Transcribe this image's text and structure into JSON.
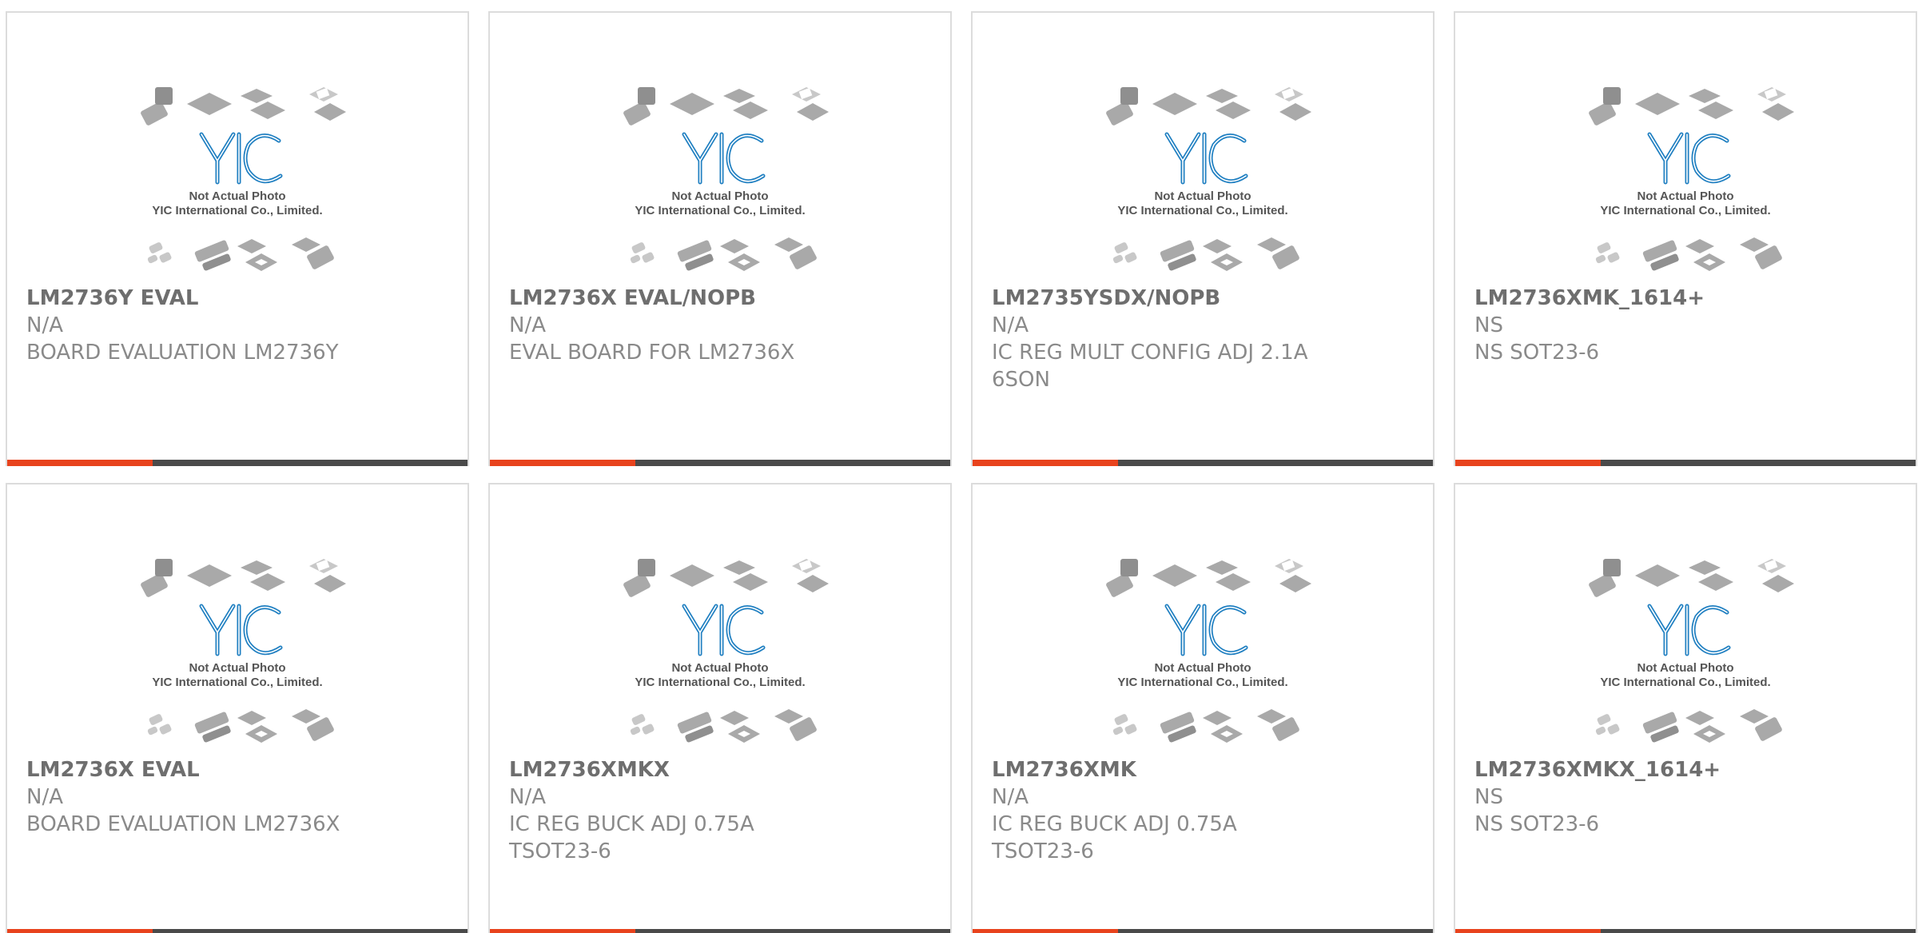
{
  "colors": {
    "accent_orange": "#e8431d",
    "accent_dark": "#4a4a4a",
    "card_border": "#dcdcdc",
    "part_number_text": "#6e6e6e",
    "meta_text": "#8a8a8a",
    "logo_blue": "#1f7fc1"
  },
  "placeholder_image": {
    "logo_text": "YIC",
    "caption_line1": "Not Actual Photo",
    "caption_line2": "YIC International Co., Limited."
  },
  "products": [
    {
      "part_number": "LM2736Y EVAL",
      "manufacturer": "N/A",
      "description": "BOARD EVALUATION LM2736Y"
    },
    {
      "part_number": "LM2736X EVAL/NOPB",
      "manufacturer": "N/A",
      "description": "EVAL BOARD FOR LM2736X"
    },
    {
      "part_number": "LM2735YSDX/NOPB",
      "manufacturer": "N/A",
      "description": "IC REG MULT CONFIG ADJ 2.1A 6SON"
    },
    {
      "part_number": "LM2736XMK_1614+",
      "manufacturer": "NS",
      "description": "NS SOT23-6"
    },
    {
      "part_number": "LM2736X EVAL",
      "manufacturer": "N/A",
      "description": "BOARD EVALUATION LM2736X"
    },
    {
      "part_number": "LM2736XMKX",
      "manufacturer": "N/A",
      "description": "IC REG BUCK ADJ 0.75A TSOT23-6"
    },
    {
      "part_number": "LM2736XMK",
      "manufacturer": "N/A",
      "description": "IC REG BUCK ADJ 0.75A TSOT23-6"
    },
    {
      "part_number": "LM2736XMKX_1614+",
      "manufacturer": "NS",
      "description": "NS SOT23-6"
    }
  ]
}
